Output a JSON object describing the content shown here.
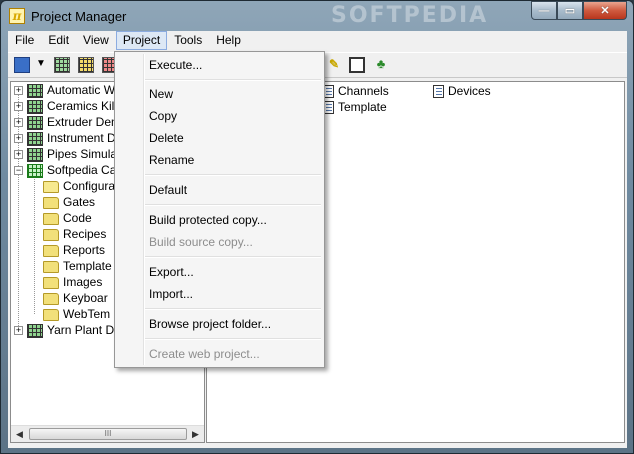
{
  "window": {
    "title": "Project Manager",
    "app_icon_glyph": "π",
    "watermark": "SOFTPEDIA",
    "minimize_glyph": "—",
    "maximize_glyph": "▭",
    "close_glyph": "✕"
  },
  "menubar": {
    "items": [
      {
        "label": "File"
      },
      {
        "label": "Edit"
      },
      {
        "label": "View"
      },
      {
        "label": "Project"
      },
      {
        "label": "Tools"
      },
      {
        "label": "Help"
      }
    ]
  },
  "project_menu": {
    "items": [
      {
        "label": "Execute...",
        "enabled": true
      },
      {
        "label": "New",
        "enabled": true
      },
      {
        "label": "Copy",
        "enabled": true
      },
      {
        "label": "Delete",
        "enabled": true
      },
      {
        "label": "Rename",
        "enabled": true
      },
      {
        "label": "Default",
        "enabled": true
      },
      {
        "label": "Build protected copy...",
        "enabled": true
      },
      {
        "label": "Build source copy...",
        "enabled": false
      },
      {
        "label": "Export...",
        "enabled": true
      },
      {
        "label": "Import...",
        "enabled": true
      },
      {
        "label": "Browse project folder...",
        "enabled": true
      },
      {
        "label": "Create web project...",
        "enabled": false
      }
    ]
  },
  "tree": {
    "projects": [
      {
        "label": "Automatic W"
      },
      {
        "label": "Ceramics Kiln"
      },
      {
        "label": "Extruder Dem"
      },
      {
        "label": "Instrument De"
      },
      {
        "label": "Pipes Simulat"
      },
      {
        "label": "Softpedia Ca"
      },
      {
        "label": "Yarn Plant De"
      }
    ],
    "folders": [
      {
        "label": "Configura"
      },
      {
        "label": "Gates"
      },
      {
        "label": "Code"
      },
      {
        "label": "Recipes"
      },
      {
        "label": "Reports"
      },
      {
        "label": "Template"
      },
      {
        "label": "Images"
      },
      {
        "label": "Keyboar"
      },
      {
        "label": "WebTem"
      }
    ],
    "expand_glyph": "+",
    "collapse_glyph": "−",
    "scroll_left": "◀",
    "scroll_right": "▶",
    "scroll_grip": "III"
  },
  "list": {
    "items": [
      {
        "label": "Channels"
      },
      {
        "label": "Devices"
      },
      {
        "label": "Template"
      }
    ]
  },
  "toolbar": {
    "icons": [
      "project-icon",
      "dropdown-arrow-icon",
      "grid-icon",
      "grid-star-icon",
      "grid-delete-icon",
      "wand-icon",
      "frame-icon",
      "tree-icon"
    ]
  }
}
